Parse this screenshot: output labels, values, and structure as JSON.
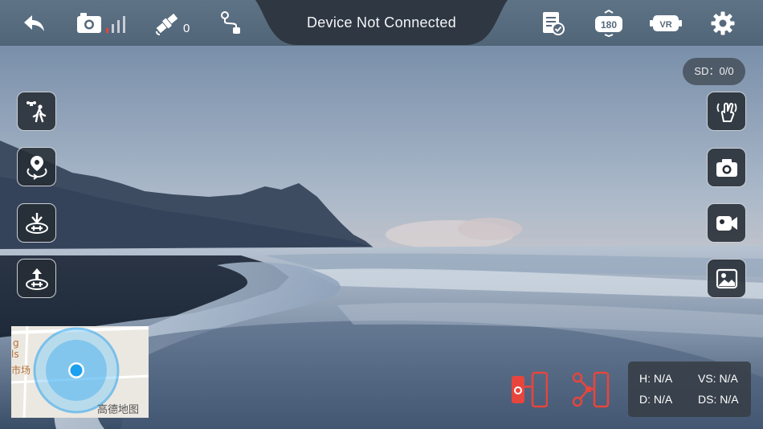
{
  "header": {
    "title": "Device Not Connected",
    "satellite_count": "0",
    "icons": [
      "back-arrow-icon",
      "camera-signal-icon",
      "satellite-icon",
      "route-icon",
      "flight-log-icon",
      "rotate-180-icon",
      "vr-headset-icon",
      "gear-icon"
    ],
    "rotate_label": "180",
    "vr_label": "VR"
  },
  "status": {
    "sd": "SD：0/0"
  },
  "left_controls": [
    "follow-me-icon",
    "waypoint-orbit-icon",
    "landing-icon",
    "takeoff-icon"
  ],
  "right_controls": [
    "gesture-icon",
    "camera-icon",
    "video-icon",
    "gallery-icon"
  ],
  "minimap": {
    "labels": [
      "g",
      "ls",
      "市场"
    ],
    "logo": "高德地图"
  },
  "telemetry": {
    "h": "H: N/A",
    "vs": "VS: N/A",
    "d": "D: N/A",
    "ds": "DS: N/A"
  },
  "colors": {
    "topbar": "#56697c",
    "accent_red": "#e8453c",
    "map_blue": "#1ea0f0"
  }
}
